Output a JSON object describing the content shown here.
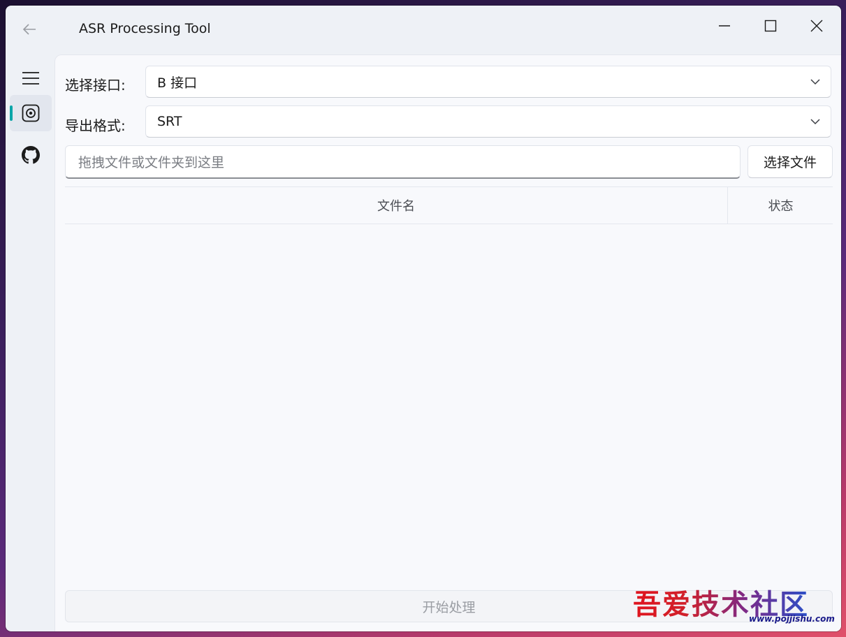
{
  "window": {
    "title": "ASR Processing Tool"
  },
  "nav": {
    "items": [
      {
        "id": "menu",
        "icon": "hamburger-menu-icon"
      },
      {
        "id": "asr",
        "icon": "record-icon",
        "selected": true
      },
      {
        "id": "github",
        "icon": "github-icon"
      }
    ],
    "accent_color": "#0aa5a8"
  },
  "form": {
    "interface_label": "选择接口:",
    "interface_value": "B 接口",
    "format_label": "导出格式:",
    "format_value": "SRT",
    "drop_placeholder": "拖拽文件或文件夹到这里",
    "select_file_label": "选择文件"
  },
  "table": {
    "columns": [
      "文件名",
      "状态"
    ],
    "rows": []
  },
  "actions": {
    "start_label": "开始处理"
  },
  "watermark": {
    "text": "吾爱技术社区",
    "url": "www.pojjishu.com"
  }
}
